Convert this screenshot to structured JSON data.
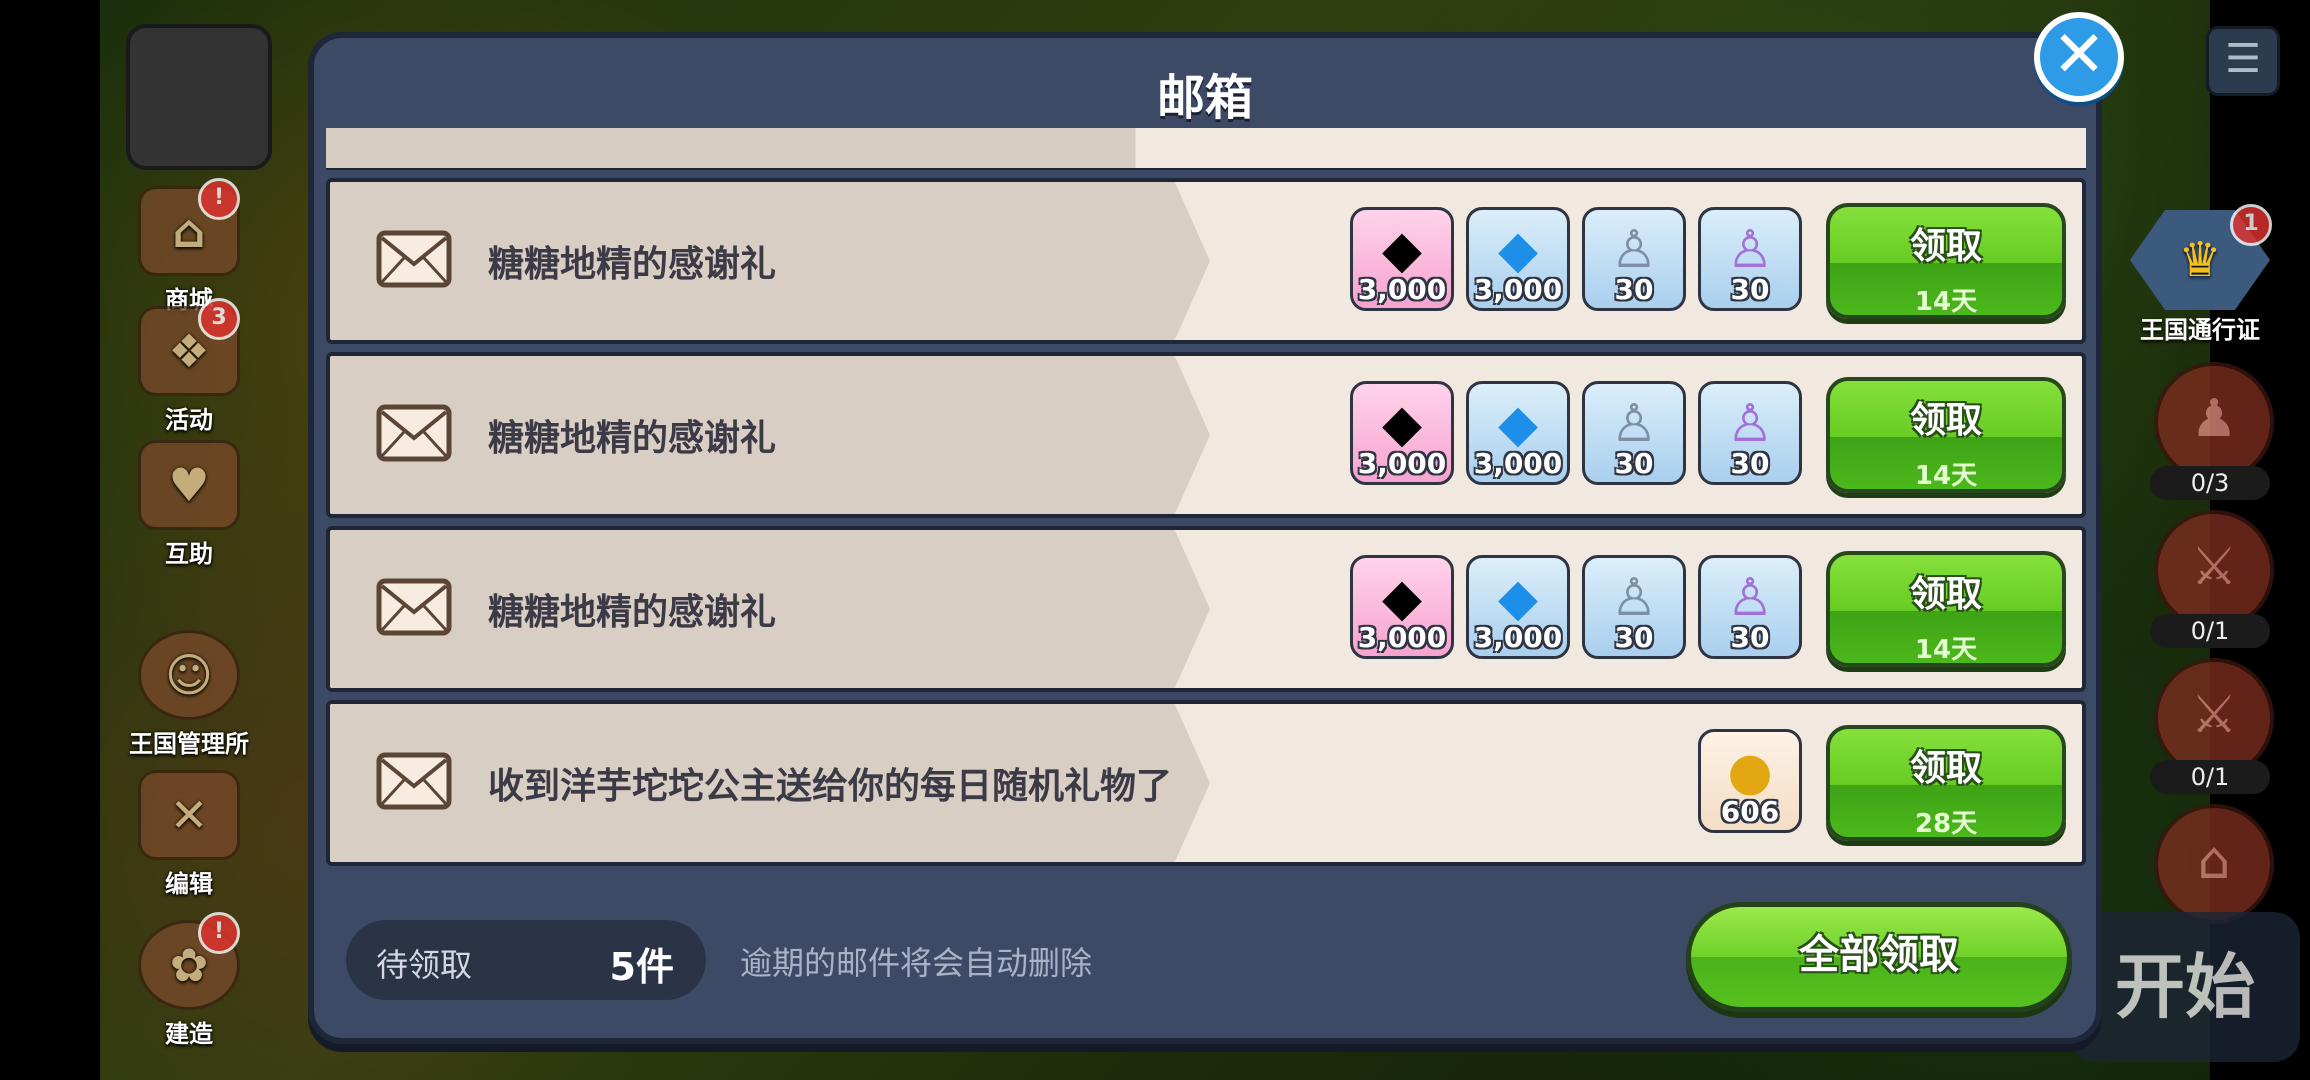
{
  "dialog": {
    "title": "邮箱",
    "close_icon": "close-icon"
  },
  "sidebar_left": [
    {
      "label": "商城",
      "badge": "!",
      "icon": "shop-stall-icon"
    },
    {
      "label": "活动",
      "badge": "3",
      "icon": "gift-box-icon"
    },
    {
      "label": "互助",
      "badge": "",
      "icon": "handshake-icon"
    },
    {
      "label": "王国管理所",
      "badge": "",
      "icon": "cookie-manager-icon"
    },
    {
      "label": "编辑",
      "badge": "",
      "icon": "edit-tools-icon"
    },
    {
      "label": "建造",
      "badge": "!",
      "icon": "build-icon"
    }
  ],
  "sidebar_right": {
    "pass": {
      "label": "王国通行证",
      "badge": "1",
      "icon": "crown-icon"
    },
    "counters": [
      {
        "value": "0/3",
        "icon": "npc-icon"
      },
      {
        "value": "0/1",
        "icon": "sword-icon"
      },
      {
        "value": "0/1",
        "icon": "sword-icon"
      }
    ]
  },
  "start_button": {
    "label": "开始"
  },
  "mails": [
    {
      "title": "糖糖地精的感谢礼",
      "claim_label": "领取",
      "expires": "14天",
      "items": [
        {
          "icon": "rainbow-cube-icon",
          "qty": "3,000",
          "kind": "crystal"
        },
        {
          "icon": "diamond-icon",
          "qty": "3,000",
          "kind": "normal"
        },
        {
          "icon": "cookie-cutter-silver-icon",
          "qty": "30",
          "kind": "normal"
        },
        {
          "icon": "cookie-cutter-purple-icon",
          "qty": "30",
          "kind": "normal"
        }
      ]
    },
    {
      "title": "糖糖地精的感谢礼",
      "claim_label": "领取",
      "expires": "14天",
      "items": [
        {
          "icon": "rainbow-cube-icon",
          "qty": "3,000",
          "kind": "crystal"
        },
        {
          "icon": "diamond-icon",
          "qty": "3,000",
          "kind": "normal"
        },
        {
          "icon": "cookie-cutter-silver-icon",
          "qty": "30",
          "kind": "normal"
        },
        {
          "icon": "cookie-cutter-purple-icon",
          "qty": "30",
          "kind": "normal"
        }
      ]
    },
    {
      "title": "糖糖地精的感谢礼",
      "claim_label": "领取",
      "expires": "14天",
      "items": [
        {
          "icon": "rainbow-cube-icon",
          "qty": "3,000",
          "kind": "crystal"
        },
        {
          "icon": "diamond-icon",
          "qty": "3,000",
          "kind": "normal"
        },
        {
          "icon": "cookie-cutter-silver-icon",
          "qty": "30",
          "kind": "normal"
        },
        {
          "icon": "cookie-cutter-purple-icon",
          "qty": "30",
          "kind": "normal"
        }
      ]
    },
    {
      "title": "收到洋芋坨坨公主送给你的每日随机礼物了",
      "claim_label": "领取",
      "expires": "28天",
      "items": [
        {
          "icon": "gold-crown-coin-icon",
          "qty": "606",
          "kind": "gold"
        }
      ]
    }
  ],
  "footer": {
    "pending_label": "待领取",
    "pending_count": "5件",
    "note": "逾期的邮件将会自动删除",
    "claim_all_label": "全部领取"
  },
  "colors": {
    "dialog_bg": "#3d4a66",
    "claim_green": "#66cc23",
    "close_blue": "#2e9be6"
  }
}
